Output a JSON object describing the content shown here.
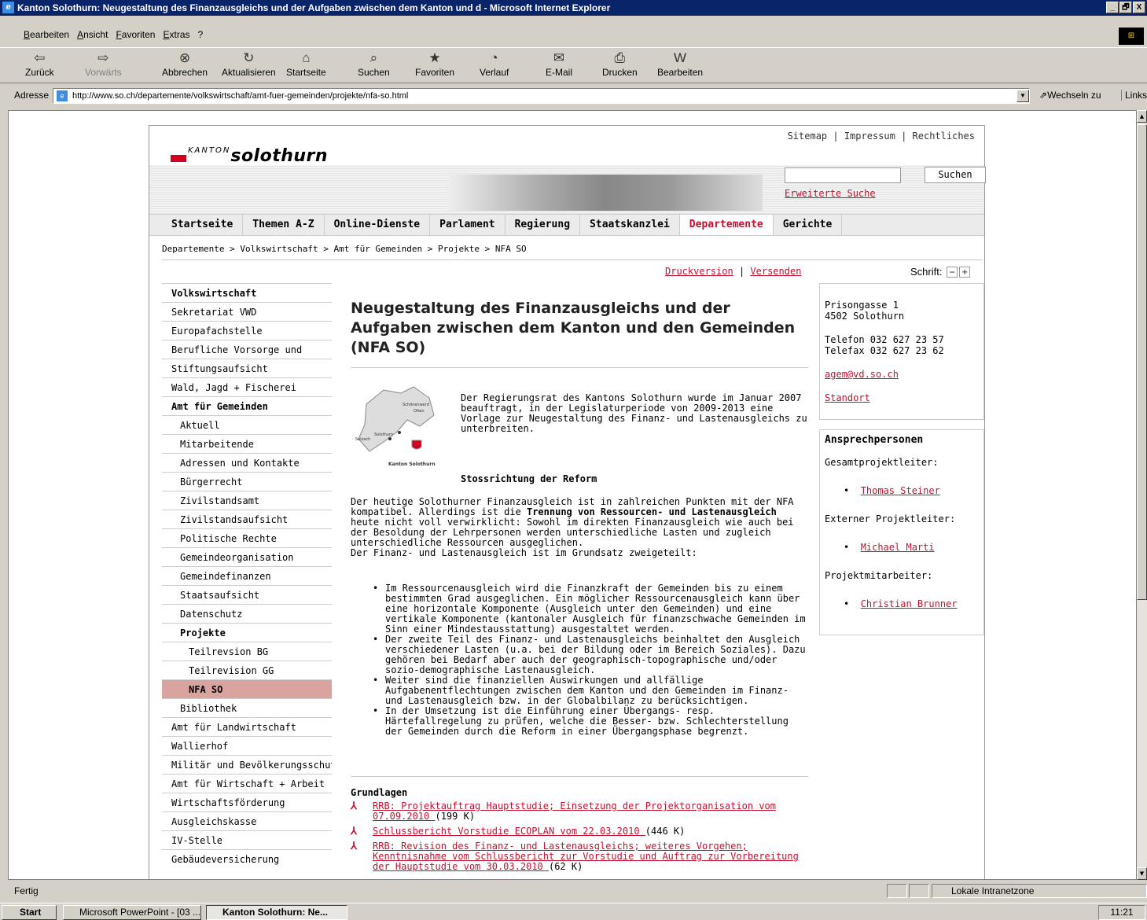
{
  "window": {
    "title": "Kanton Solothurn: Neugestaltung des Finanzausgleichs und der Aufgaben zwischen dem Kanton und d - Microsoft Internet Explorer",
    "controls": [
      "_",
      "🗗",
      "X"
    ]
  },
  "menu": {
    "items": [
      "Bearbeiten",
      "Ansicht",
      "Favoriten",
      "Extras",
      "?"
    ]
  },
  "toolbar": {
    "buttons": [
      {
        "label": "Zurück",
        "icon": "back-arrow-icon",
        "glyph": "⇦",
        "enabled": true
      },
      {
        "label": "Vorwärts",
        "icon": "forward-arrow-icon",
        "glyph": "⇨",
        "enabled": false
      },
      {
        "label": "Abbrechen",
        "icon": "stop-icon",
        "glyph": "⊗",
        "enabled": true
      },
      {
        "label": "Aktualisieren",
        "icon": "refresh-icon",
        "glyph": "↻",
        "enabled": true
      },
      {
        "label": "Startseite",
        "icon": "home-icon",
        "glyph": "⌂",
        "enabled": true
      },
      {
        "label": "Suchen",
        "icon": "search-icon",
        "glyph": "⌕",
        "enabled": true
      },
      {
        "label": "Favoriten",
        "icon": "favorites-icon",
        "glyph": "★",
        "enabled": true
      },
      {
        "label": "Verlauf",
        "icon": "history-icon",
        "glyph": "◔",
        "enabled": true
      },
      {
        "label": "E-Mail",
        "icon": "mail-icon",
        "glyph": "✉",
        "enabled": true
      },
      {
        "label": "Drucken",
        "icon": "printer-icon",
        "glyph": "⎙",
        "enabled": true
      },
      {
        "label": "Bearbeiten",
        "icon": "edit-icon",
        "glyph": "W",
        "enabled": true
      }
    ]
  },
  "address": {
    "label": "Adresse",
    "url": "http://www.so.ch/departemente/volkswirtschaft/amt-fuer-gemeinden/projekte/nfa-so.html",
    "go_label": "Wechseln zu",
    "links_label": "Links"
  },
  "site": {
    "logo_small": "KANTON",
    "logo_big": "solothurn",
    "top_links": "Sitemap | Impressum | Rechtliches",
    "search_button": "Suchen",
    "advanced_search": "Erweiterte Suche",
    "nav": [
      "Startseite",
      "Themen A-Z",
      "Online-Dienste",
      "Parlament",
      "Regierung",
      "Staatskanzlei",
      "Departemente",
      "Gerichte"
    ],
    "nav_active": "Departemente",
    "breadcrumb": "Departemente > Volkswirtschaft > Amt für Gemeinden > Projekte > NFA SO",
    "print_link": "Druckversion",
    "send_link": "Versenden",
    "font_label": "Schrift:",
    "font_minus": "−",
    "font_plus": "+"
  },
  "leftnav": [
    {
      "label": "Volkswirtschaft",
      "level": 1,
      "bold": true
    },
    {
      "label": "Sekretariat VWD",
      "level": 1
    },
    {
      "label": "Europafachstelle",
      "level": 1
    },
    {
      "label": "Berufliche Vorsorge und",
      "level": 1
    },
    {
      "label": "Stiftungsaufsicht",
      "level": 1
    },
    {
      "label": "Wald, Jagd + Fischerei",
      "level": 1
    },
    {
      "label": "Amt für Gemeinden",
      "level": 1,
      "bold": true
    },
    {
      "label": "Aktuell",
      "level": 2
    },
    {
      "label": "Mitarbeitende",
      "level": 2
    },
    {
      "label": "Adressen und Kontakte",
      "level": 2
    },
    {
      "label": "Bürgerrecht",
      "level": 2
    },
    {
      "label": "Zivilstandsamt",
      "level": 2
    },
    {
      "label": "Zivilstandsaufsicht",
      "level": 2
    },
    {
      "label": "Politische Rechte",
      "level": 2
    },
    {
      "label": "Gemeindeorganisation",
      "level": 2
    },
    {
      "label": "Gemeindefinanzen",
      "level": 2
    },
    {
      "label": "Staatsaufsicht",
      "level": 2
    },
    {
      "label": "Datenschutz",
      "level": 2
    },
    {
      "label": "Projekte",
      "level": 2,
      "bold": true
    },
    {
      "label": "Teilrevsion BG",
      "level": 3
    },
    {
      "label": "Teilrevision GG",
      "level": 3
    },
    {
      "label": "NFA SO",
      "level": 3,
      "selected": true
    },
    {
      "label": "Bibliothek",
      "level": 2
    },
    {
      "label": "Amt für Landwirtschaft",
      "level": 1
    },
    {
      "label": "Wallierhof",
      "level": 1
    },
    {
      "label": "Militär und Bevölkerungsschutz",
      "level": 1
    },
    {
      "label": "Amt für Wirtschaft + Arbeit",
      "level": 1
    },
    {
      "label": "Wirtschaftsförderung",
      "level": 1
    },
    {
      "label": "Ausgleichskasse",
      "level": 1
    },
    {
      "label": "IV-Stelle",
      "level": 1
    },
    {
      "label": "Gebäudeversicherung",
      "level": 1
    }
  ],
  "content": {
    "title": "Neugestaltung des Finanzausgleichs und der Aufgaben zwischen dem Kanton und den Gemeinden (NFA SO)",
    "map_labels": [
      "Schönenwerd",
      "Olten",
      "Selzach",
      "Solothurn",
      "Kanton Solothurn"
    ],
    "intro": "Der Regierungsrat des Kantons Solothurn wurde im Januar 2007 beauftragt, in der Legislaturperiode von 2009-2013 eine Vorlage zur Neugestaltung des Finanz- und Lastenausgleichs zu unterbreiten.",
    "subheading": "Stossrichtung der Reform",
    "para_a": "Der heutige Solothurner Finanzausgleich ist in zahlreichen Punkten mit der NFA kompatibel. Allerdings ist die ",
    "para_bold": "Trennung von Ressourcen- und Lastenausgleich",
    "para_b": " heute nicht voll verwirklicht: Sowohl im direkten Finanzausgleich wie auch bei der Besoldung der Lehrpersonen werden unterschiedliche Lasten und zugleich unterschiedliche Ressourcen ausgeglichen.",
    "para_c": "Der Finanz- und Lastenausgleich ist im Grundsatz zweigeteilt:",
    "bullets": [
      "Im Ressourcenausgleich wird die Finanzkraft der Gemeinden bis zu einem bestimmten Grad ausgeglichen. Ein möglicher Ressourcenausgleich kann über eine horizontale Komponente (Ausgleich unter den Gemeinden) und eine vertikale Komponente (kantonaler Ausgleich für finanzschwache Gemeinden im Sinn einer Mindestausstattung) ausgestaltet werden.",
      "Der zweite Teil des Finanz- und Lastenausgleichs beinhaltet den Ausgleich verschiedener Lasten (u.a. bei der Bildung oder im Bereich Soziales). Dazu gehören bei Bedarf aber auch der geographisch-topographische und/oder sozio-demographische Lastenausgleich.",
      "Weiter sind die finanziellen Auswirkungen und allfällige Aufgabenentflechtungen zwischen dem Kanton und den Gemeinden im Finanz- und Lastenausgleich bzw. in der Globalbilanz zu berücksichtigen.",
      "In der Umsetzung ist die Einführung einer Übergangs- resp. Härtefallregelung zu prüfen, welche die Besser- bzw. Schlechterstellung der Gemeinden durch die Reform in einer Übergangsphase begrenzt."
    ],
    "grundlagen_title": "Grundlagen",
    "documents": [
      {
        "title": "RRB: Projektauftrag Hauptstudie; Einsetzung der Projektorganisation vom 07.09.2010 ",
        "size": " (199 K)"
      },
      {
        "title": "Schlussbericht Vorstudie ECOPLAN vom 22.03.2010 ",
        "size": " (446 K)"
      },
      {
        "title": "RRB: Revision des Finanz- und Lastenausgleichs; weiteres Vorgehen; Kenntnisnahme vom Schlussbericht zur Vorstudie und Auftrag zur Vorbereitung der Hauptstudie vom 30.03.2010 ",
        "size": " (62 K)"
      }
    ]
  },
  "contact": {
    "street": "Prisongasse 1",
    "city": "4502 Solothurn",
    "phone": "Telefon 032 627 23 57",
    "fax": "Telefax 032 627 23 62",
    "email": "agem@vd.so.ch",
    "location": "Standort"
  },
  "contacts_box": {
    "title": "Ansprechpersonen",
    "groups": [
      {
        "role": "Gesamtprojektleiter:",
        "person": "Thomas Steiner"
      },
      {
        "role": "Externer Projektleiter:",
        "person": "Michael Marti"
      },
      {
        "role": "Projektmitarbeiter:",
        "person": "Christian Brunner"
      }
    ]
  },
  "status": {
    "text": "Fertig",
    "zone": "Lokale Intranetzone"
  },
  "taskbar": {
    "start": "Start",
    "tasks": [
      {
        "label": "Microsoft PowerPoint - [03 ...",
        "active": false
      },
      {
        "label": "Kanton Solothurn: Ne...",
        "active": true
      }
    ],
    "clock": "11:21"
  },
  "colors": {
    "accent": "#c8102e",
    "titlebar": "#0a246a",
    "selected_nav": "#d9a39f"
  }
}
